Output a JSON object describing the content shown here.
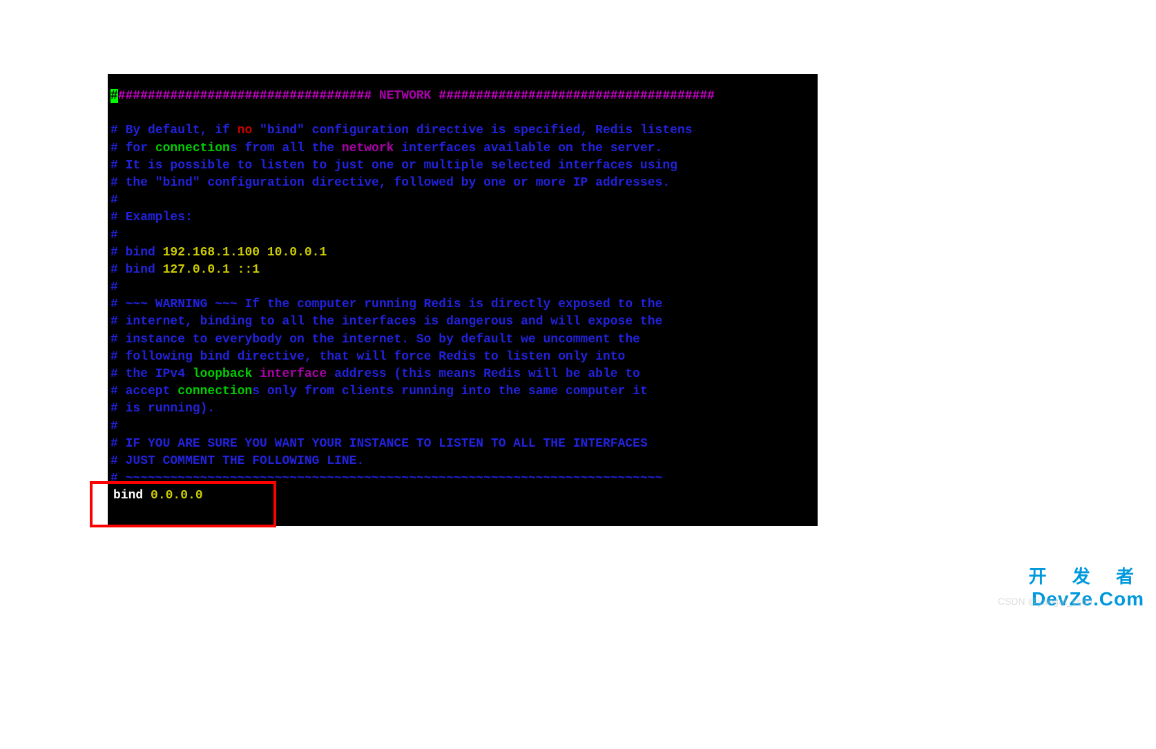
{
  "header": {
    "hash_prefix": "################################## ",
    "title": "NETWORK",
    "hash_suffix": " #####################################"
  },
  "comments": {
    "l1_p1": "# By default, if ",
    "l1_no": "no",
    "l1_p2": " \"bind\" configuration directive is specified, Redis listens",
    "l2_p1": "# for ",
    "l2_conn": "connection",
    "l2_p2": "s from all the ",
    "l2_network": "network",
    "l2_p3": " interfaces available on the server.",
    "l3": "# It is possible to listen to just one or multiple selected interfaces using",
    "l4": "# the \"bind\" configuration directive, followed by one or more IP addresses.",
    "l5": "#",
    "l6": "# Examples:",
    "l7": "#",
    "l8_p1": "# bind ",
    "l8_ips": "192.168.1.100 10.0.0.1",
    "l9_p1": "# bind ",
    "l9_ips": "127.0.0.1 ::1",
    "l10": "#",
    "l11": "# ~~~ WARNING ~~~ If the computer running Redis is directly exposed to the",
    "l12": "# internet, binding to all the interfaces is dangerous and will expose the",
    "l13": "# instance to everybody on the internet. So by default we uncomment the",
    "l14": "# following bind directive, that will force Redis to listen only into",
    "l15_p1": "# the IPv4 ",
    "l15_loopback": "loopback",
    "l15_sp": " ",
    "l15_interface": "interface",
    "l15_p2": " address (this means Redis will be able to",
    "l16_p1": "# accept ",
    "l16_conn": "connection",
    "l16_p2": "s only from clients running into the same computer it",
    "l17": "# is running).",
    "l18": "#",
    "l19": "# IF YOU ARE SURE YOU WANT YOUR INSTANCE TO LISTEN TO ALL THE INTERFACES",
    "l20": "# JUST COMMENT THE FOLLOWING LINE.",
    "l21": "# ~~~~~~~~~~~~~~~~~~~~~~~~~~~~~~~~~~~~~~~~~~~~~~~~~~~~~~~~~~~~~~~~~~~~~~~~"
  },
  "bind": {
    "keyword": "bind ",
    "value": "0.0.0.0"
  },
  "watermark": {
    "cn": "开 发 者",
    "en": "DevZe.Com",
    "csdn": "CSDN @yangat_csdn"
  }
}
